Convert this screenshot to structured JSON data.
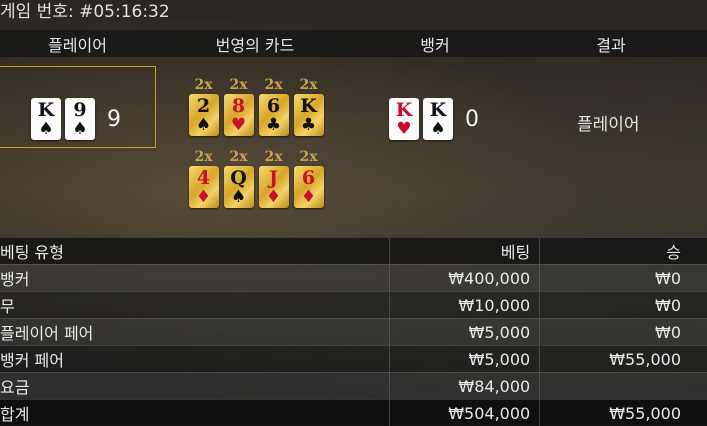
{
  "round": {
    "title": "게임 번호: #05:16:32"
  },
  "header": {
    "player": "플레이어",
    "bonus_cards": "번영의 카드",
    "banker": "뱅커",
    "result": "결과"
  },
  "player_hand": {
    "cards": [
      {
        "rank": "K",
        "suit": "♠",
        "color": "black"
      },
      {
        "rank": "9",
        "suit": "♠",
        "color": "black"
      }
    ],
    "score": "9"
  },
  "banker_hand": {
    "cards": [
      {
        "rank": "K",
        "suit": "♥",
        "color": "red"
      },
      {
        "rank": "K",
        "suit": "♠",
        "color": "black"
      }
    ],
    "score": "0"
  },
  "bonus_cards": [
    {
      "mult": "2x",
      "rank": "2",
      "suit": "♠",
      "color": "black"
    },
    {
      "mult": "2x",
      "rank": "8",
      "suit": "♥",
      "color": "red"
    },
    {
      "mult": "2x",
      "rank": "6",
      "suit": "♣",
      "color": "black"
    },
    {
      "mult": "2x",
      "rank": "K",
      "suit": "♣",
      "color": "black"
    },
    {
      "mult": "2x",
      "rank": "4",
      "suit": "♦",
      "color": "red"
    },
    {
      "mult": "2x",
      "rank": "Q",
      "suit": "♠",
      "color": "black"
    },
    {
      "mult": "2x",
      "rank": "J",
      "suit": "♦",
      "color": "red"
    },
    {
      "mult": "2x",
      "rank": "6",
      "suit": "♦",
      "color": "red"
    }
  ],
  "result": {
    "winner": "플레이어"
  },
  "bets_table": {
    "headers": {
      "type": "베팅 유형",
      "bet": "베팅",
      "win": "승"
    },
    "rows": [
      {
        "type": "뱅커",
        "bet": "₩400,000",
        "win": "₩0"
      },
      {
        "type": "무",
        "bet": "₩10,000",
        "win": "₩0"
      },
      {
        "type": "플레이어 페어",
        "bet": "₩5,000",
        "win": "₩0"
      },
      {
        "type": "뱅커 페어",
        "bet": "₩5,000",
        "win": "₩55,000"
      },
      {
        "type": "요금",
        "bet": "₩84,000",
        "win": ""
      }
    ],
    "total": {
      "type": "합계",
      "bet": "₩504,000",
      "win": "₩55,000"
    }
  },
  "colors": {
    "gold_border": "#c8a020",
    "card_red": "#c8102e",
    "multiplier": "#c9a257"
  }
}
